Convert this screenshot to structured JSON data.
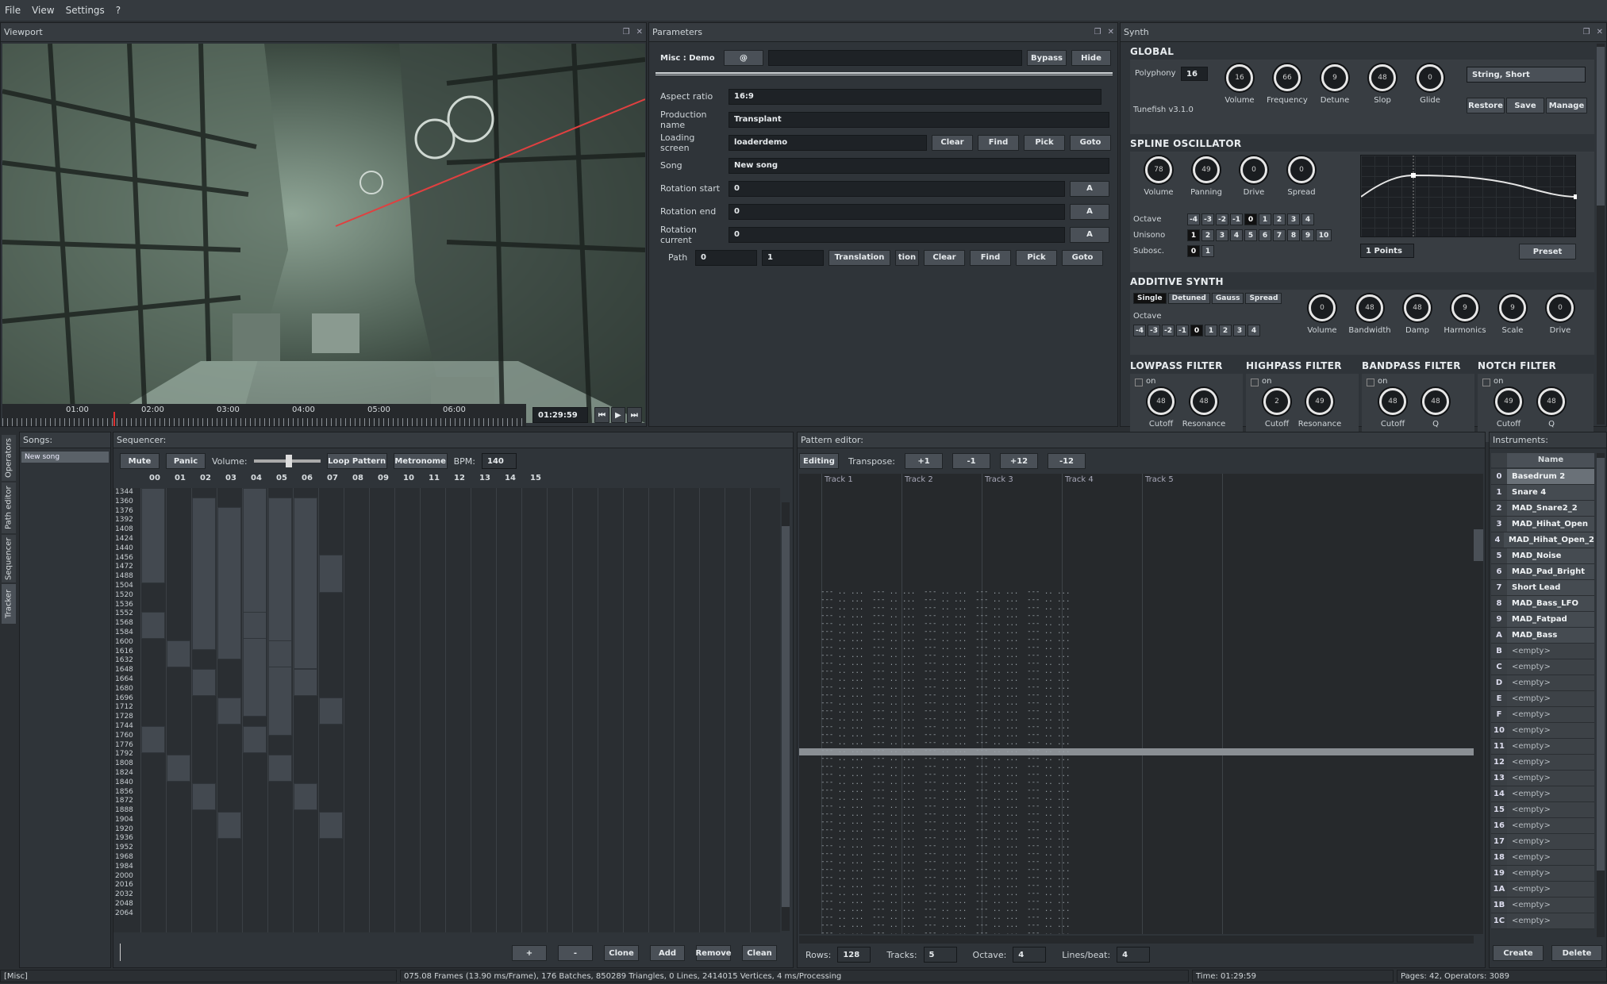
{
  "menu": [
    "File",
    "View",
    "Settings",
    "?"
  ],
  "viewport": {
    "title": "Viewport",
    "times": [
      "01:00",
      "02:00",
      "03:00",
      "04:00",
      "05:00",
      "06:00"
    ],
    "current_time": "01:29:59"
  },
  "parameters": {
    "title": "Parameters",
    "op_name": "Misc : Demo",
    "at_label": "@",
    "bypass": "Bypass",
    "hide": "Hide",
    "rows": [
      {
        "label": "Aspect ratio",
        "value": "16:9"
      },
      {
        "label": "Production name",
        "value": "Transplant"
      },
      {
        "label": "Loading screen",
        "value": "loaderdemo"
      },
      {
        "label": "Song",
        "value": "New song"
      },
      {
        "label": "Rotation start",
        "value": "0"
      },
      {
        "label": "Rotation end",
        "value": "0"
      },
      {
        "label": "Rotation current",
        "value": "0"
      }
    ],
    "clear": "Clear",
    "find": "Find",
    "pick": "Pick",
    "goto": "Goto",
    "a": "A",
    "path_label": "Path",
    "path_v1": "0",
    "path_v2": "1",
    "translation": "Translation",
    "tion": "tion"
  },
  "synth": {
    "title": "Synth",
    "global": {
      "title": "GLOBAL",
      "polyphony_label": "Polyphony",
      "polyphony": "16",
      "version": "Tunefish v3.1.0",
      "knobs": [
        {
          "v": "16",
          "l": "Volume"
        },
        {
          "v": "66",
          "l": "Frequency"
        },
        {
          "v": "9",
          "l": "Detune"
        },
        {
          "v": "48",
          "l": "Slop"
        },
        {
          "v": "0",
          "l": "Glide"
        }
      ],
      "preset": "String, Short",
      "restore": "Restore",
      "save": "Save",
      "manage": "Manage"
    },
    "spline": {
      "title": "SPLINE OSCILLATOR",
      "knobs": [
        {
          "v": "78",
          "l": "Volume"
        },
        {
          "v": "49",
          "l": "Panning"
        },
        {
          "v": "0",
          "l": "Drive"
        },
        {
          "v": "0",
          "l": "Spread"
        }
      ],
      "octave_label": "Octave",
      "octave": [
        "-4",
        "-3",
        "-2",
        "-1",
        "0",
        "1",
        "2",
        "3",
        "4"
      ],
      "unisono_label": "Unisono",
      "unisono": [
        "1",
        "2",
        "3",
        "4",
        "5",
        "6",
        "7",
        "8",
        "9",
        "10"
      ],
      "subosc_label": "Subosc.",
      "subosc": [
        "0",
        "1"
      ],
      "points": "1 Points",
      "preset": "Preset"
    },
    "additive": {
      "title": "ADDITIVE SYNTH",
      "modes": [
        "Single",
        "Detuned",
        "Gauss",
        "Spread"
      ],
      "octave_label": "Octave",
      "octave": [
        "-4",
        "-3",
        "-2",
        "-1",
        "0",
        "1",
        "2",
        "3",
        "4"
      ],
      "knobs": [
        {
          "v": "0",
          "l": "Volume"
        },
        {
          "v": "48",
          "l": "Bandwidth"
        },
        {
          "v": "48",
          "l": "Damp"
        },
        {
          "v": "9",
          "l": "Harmonics"
        },
        {
          "v": "9",
          "l": "Scale"
        },
        {
          "v": "0",
          "l": "Drive"
        }
      ]
    },
    "filters": [
      {
        "title": "LOWPASS FILTER",
        "on": "on",
        "knobs": [
          {
            "v": "48",
            "l": "Cutoff"
          },
          {
            "v": "48",
            "l": "Resonance"
          }
        ]
      },
      {
        "title": "HIGHPASS FILTER",
        "on": "on",
        "knobs": [
          {
            "v": "2",
            "l": "Cutoff"
          },
          {
            "v": "49",
            "l": "Resonance"
          }
        ]
      },
      {
        "title": "BANDPASS FILTER",
        "on": "on",
        "knobs": [
          {
            "v": "48",
            "l": "Cutoff"
          },
          {
            "v": "48",
            "l": "Q"
          }
        ]
      },
      {
        "title": "NOTCH FILTER",
        "on": "on",
        "knobs": [
          {
            "v": "49",
            "l": "Cutoff"
          },
          {
            "v": "48",
            "l": "Q"
          }
        ]
      }
    ]
  },
  "sidetabs": [
    "Operators",
    "Path editor",
    "Sequencer",
    "Tracker"
  ],
  "songs": {
    "title": "Songs:",
    "items": [
      "New song"
    ]
  },
  "sequencer": {
    "title": "Sequencer:",
    "mute": "Mute",
    "panic": "Panic",
    "volume_label": "Volume:",
    "loop": "Loop Pattern",
    "metronome": "Metronome",
    "bpm_label": "BPM:",
    "bpm": "140",
    "cols": [
      "00",
      "01",
      "02",
      "03",
      "04",
      "05",
      "06",
      "07",
      "08",
      "09",
      "10",
      "11",
      "12",
      "13",
      "14",
      "15"
    ],
    "rows": [
      "1344",
      "1360",
      "1376",
      "1392",
      "1408",
      "1424",
      "1440",
      "1456",
      "1472",
      "1488",
      "1504",
      "1520",
      "1536",
      "1552",
      "1568",
      "1584",
      "1600",
      "1616",
      "1632",
      "1648",
      "1664",
      "1680",
      "1696",
      "1712",
      "1728",
      "1744",
      "1760",
      "1776",
      "1792",
      "1808",
      "1824",
      "1840",
      "1856",
      "1872",
      "1888",
      "1904",
      "1920",
      "1936",
      "1952",
      "1968",
      "1984",
      "2000",
      "2016",
      "2032",
      "2048",
      "2064"
    ],
    "plus": "+",
    "minus": "-",
    "clone": "Clone",
    "add": "Add",
    "remove": "Remove",
    "clean": "Clean"
  },
  "pattern": {
    "title": "Pattern editor:",
    "editing": "Editing",
    "transpose_label": "Transpose:",
    "t1": "+1",
    "t2": "-1",
    "t3": "+12",
    "t4": "-12",
    "tracks": [
      "Track 1",
      "Track 2",
      "Track 3",
      "Track 4",
      "Track 5"
    ],
    "rows_label": "Rows:",
    "rows": "128",
    "tracks_label": "Tracks:",
    "tracks_n": "5",
    "octave_label": "Octave:",
    "octave": "4",
    "lpb_label": "Lines/beat:",
    "lpb": "4"
  },
  "instruments": {
    "title": "Instruments:",
    "col": "Name",
    "items": [
      [
        "0",
        "Basedrum 2"
      ],
      [
        "1",
        "Snare 4"
      ],
      [
        "2",
        "MAD_Snare2_2"
      ],
      [
        "3",
        "MAD_Hihat_Open"
      ],
      [
        "4",
        "MAD_Hihat_Open_2"
      ],
      [
        "5",
        "MAD_Noise"
      ],
      [
        "6",
        "MAD_Pad_Bright"
      ],
      [
        "7",
        "Short Lead"
      ],
      [
        "8",
        "MAD_Bass_LFO"
      ],
      [
        "9",
        "MAD_Fatpad"
      ],
      [
        "A",
        "MAD_Bass"
      ],
      [
        "B",
        "<empty>"
      ],
      [
        "C",
        "<empty>"
      ],
      [
        "D",
        "<empty>"
      ],
      [
        "E",
        "<empty>"
      ],
      [
        "F",
        "<empty>"
      ],
      [
        "10",
        "<empty>"
      ],
      [
        "11",
        "<empty>"
      ],
      [
        "12",
        "<empty>"
      ],
      [
        "13",
        "<empty>"
      ],
      [
        "14",
        "<empty>"
      ],
      [
        "15",
        "<empty>"
      ],
      [
        "16",
        "<empty>"
      ],
      [
        "17",
        "<empty>"
      ],
      [
        "18",
        "<empty>"
      ],
      [
        "19",
        "<empty>"
      ],
      [
        "1A",
        "<empty>"
      ],
      [
        "1B",
        "<empty>"
      ],
      [
        "1C",
        "<empty>"
      ]
    ],
    "create": "Create",
    "delete": "Delete"
  },
  "statusbar": {
    "left": "[Misc]",
    "stats": "075.08 Frames (13.90 ms/Frame), 176 Batches, 850289 Triangles, 0 Lines, 2414015 Vertices, 4 ms/Processing",
    "time": "Time: 01:29:59",
    "pages": "Pages: 42, Operators: 3089"
  }
}
